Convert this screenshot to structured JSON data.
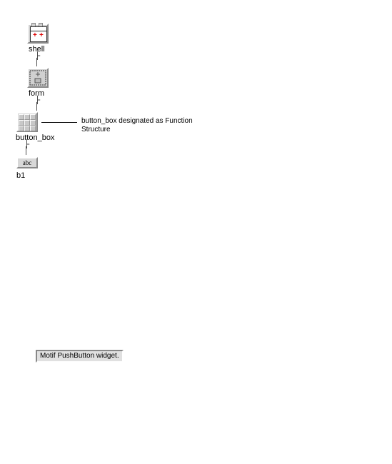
{
  "tree": {
    "shell": {
      "label": "shell"
    },
    "form": {
      "label": "form"
    },
    "button_box": {
      "label": "button_box"
    },
    "b1": {
      "label": "b1",
      "text": "abc"
    }
  },
  "annotation": {
    "line1": "button_box designated as Function",
    "line2": "Structure"
  },
  "status": {
    "text": "Motif PushButton widget."
  }
}
